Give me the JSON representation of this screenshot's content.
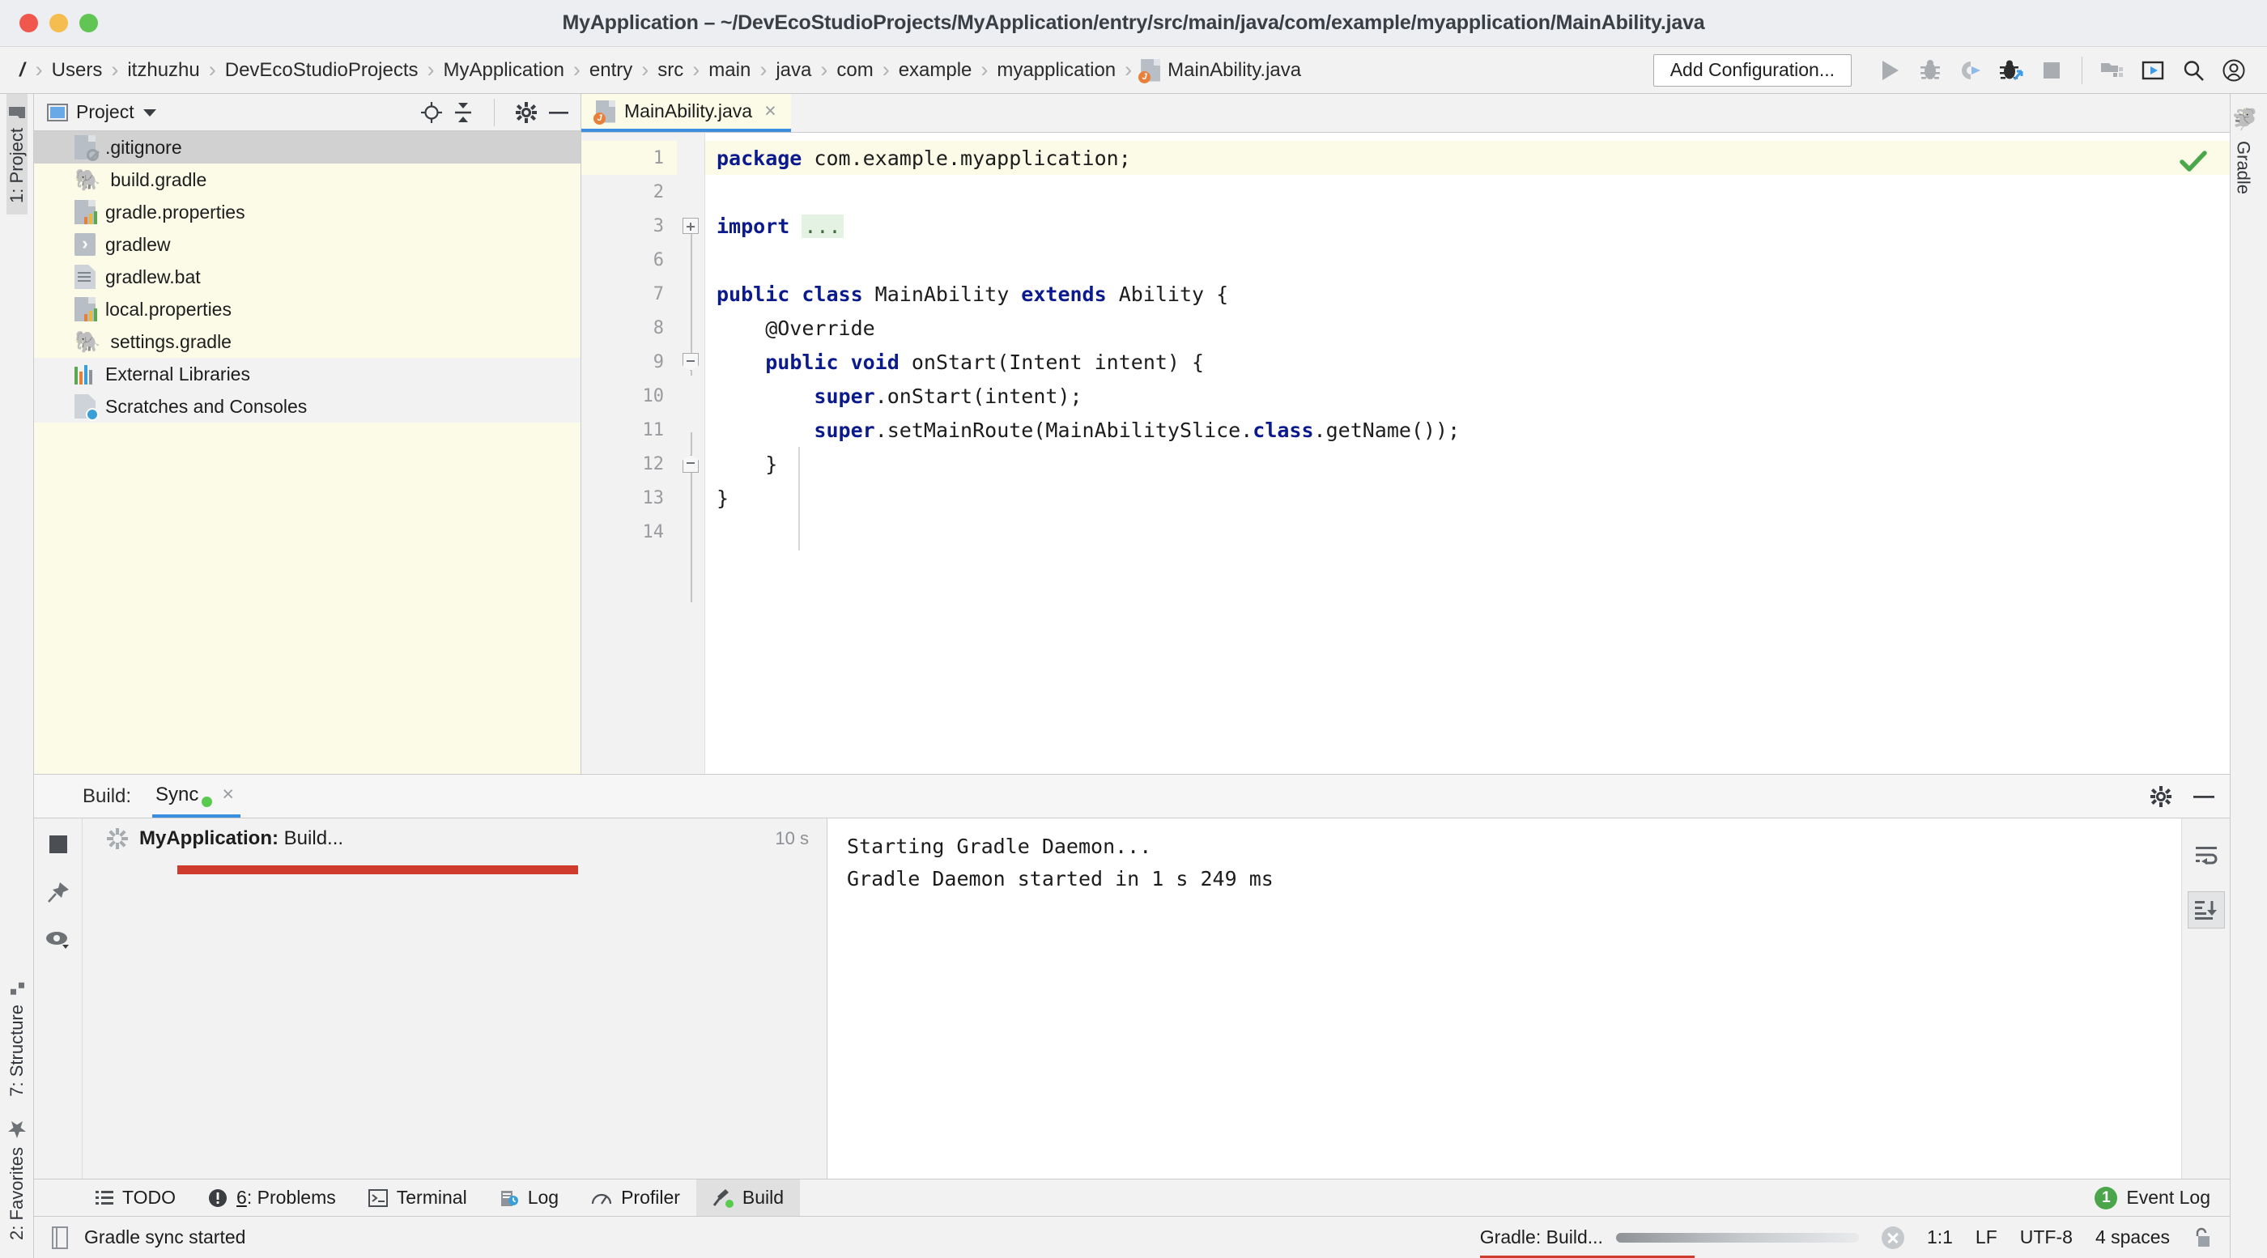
{
  "window": {
    "title": "MyApplication – ~/DevEcoStudioProjects/MyApplication/entry/src/main/java/com/example/myapplication/MainAbility.java",
    "traffic": {
      "close": "close-button",
      "minimize": "minimize-button",
      "zoom": "zoom-button"
    }
  },
  "breadcrumb": {
    "root": "/",
    "items": [
      "Users",
      "itzhuzhu",
      "DevEcoStudioProjects",
      "MyApplication",
      "entry",
      "src",
      "main",
      "java",
      "com",
      "example",
      "myapplication"
    ],
    "file": "MainAbility.java",
    "separator": "›"
  },
  "toolbar": {
    "add_configuration": "Add Configuration...",
    "icons": [
      "run-icon",
      "debug-icon",
      "run-coverage-icon",
      "profile-icon",
      "stop-icon",
      "device-manager-icon",
      "avd-manager-icon",
      "search-icon",
      "account-icon"
    ]
  },
  "left_stripe": {
    "top": [
      {
        "label": "1: Project",
        "icon": "folder-icon",
        "active": true
      }
    ],
    "bottom": [
      {
        "label": "7: Structure",
        "icon": "structure-icon"
      },
      {
        "label": "2: Favorites",
        "icon": "star-icon"
      }
    ]
  },
  "right_stripe": {
    "tabs": [
      {
        "label": "Gradle",
        "icon": "elephant-icon"
      }
    ]
  },
  "project_panel": {
    "title": "Project",
    "dropdown": "chevron-down-icon",
    "header_icons": [
      "locate-icon",
      "collapse-all-icon",
      "settings-gear-icon",
      "hide-icon"
    ],
    "items": [
      {
        "label": ".gitignore",
        "icon": "gitignore-file-icon",
        "selected": true,
        "bg": "selected"
      },
      {
        "label": "build.gradle",
        "icon": "gradle-elephant-icon",
        "bg": "cream"
      },
      {
        "label": "gradle.properties",
        "icon": "properties-file-icon",
        "bg": "cream"
      },
      {
        "label": "gradlew",
        "icon": "shell-script-icon",
        "bg": "cream"
      },
      {
        "label": "gradlew.bat",
        "icon": "bat-file-icon",
        "bg": "cream"
      },
      {
        "label": "local.properties",
        "icon": "properties-file-icon",
        "bg": "cream"
      },
      {
        "label": "settings.gradle",
        "icon": "gradle-elephant-icon",
        "bg": "cream"
      },
      {
        "label": "External Libraries",
        "icon": "libraries-icon",
        "bg": "plain"
      },
      {
        "label": "Scratches and Consoles",
        "icon": "scratches-icon",
        "bg": "plain"
      }
    ]
  },
  "editor": {
    "tab": {
      "label": "MainAbility.java",
      "icon": "java-file-icon",
      "close": "×"
    },
    "inspection_status": "check-icon",
    "line_numbers": [
      "1",
      "2",
      "3",
      "6",
      "7",
      "8",
      "9",
      "10",
      "11",
      "12",
      "13",
      "14"
    ],
    "lines": [
      {
        "num": "1",
        "highlight": true,
        "tokens": [
          {
            "t": "package",
            "c": "kw"
          },
          {
            "t": " com.example.myapplication;",
            "c": "pl"
          }
        ]
      },
      {
        "num": "2",
        "highlight": false,
        "tokens": []
      },
      {
        "num": "3",
        "highlight": false,
        "fold": "plus",
        "tokens": [
          {
            "t": "import",
            "c": "kw"
          },
          {
            "t": " ",
            "c": "pl"
          },
          {
            "t": "...",
            "c": "fold-ph"
          }
        ]
      },
      {
        "num": "6",
        "highlight": false,
        "tokens": []
      },
      {
        "num": "7",
        "highlight": false,
        "tokens": [
          {
            "t": "public class",
            "c": "kw"
          },
          {
            "t": " MainAbility ",
            "c": "pl"
          },
          {
            "t": "extends",
            "c": "kw"
          },
          {
            "t": " Ability {",
            "c": "pl"
          }
        ]
      },
      {
        "num": "8",
        "highlight": false,
        "tokens": [
          {
            "t": "    @Override",
            "c": "pl"
          }
        ]
      },
      {
        "num": "9",
        "highlight": false,
        "fold": "cap",
        "tokens": [
          {
            "t": "    ",
            "c": "pl"
          },
          {
            "t": "public void",
            "c": "kw"
          },
          {
            "t": " onStart(Intent intent) {",
            "c": "pl"
          }
        ]
      },
      {
        "num": "10",
        "highlight": false,
        "tokens": [
          {
            "t": "        ",
            "c": "pl"
          },
          {
            "t": "super",
            "c": "kw"
          },
          {
            "t": ".onStart(intent);",
            "c": "pl"
          }
        ]
      },
      {
        "num": "11",
        "highlight": false,
        "tokens": [
          {
            "t": "        ",
            "c": "pl"
          },
          {
            "t": "super",
            "c": "kw"
          },
          {
            "t": ".setMainRoute(MainAbilitySlice.",
            "c": "pl"
          },
          {
            "t": "class",
            "c": "kw"
          },
          {
            "t": ".getName());",
            "c": "pl"
          }
        ]
      },
      {
        "num": "12",
        "highlight": false,
        "fold": "capbot",
        "tokens": [
          {
            "t": "    }",
            "c": "pl"
          }
        ]
      },
      {
        "num": "13",
        "highlight": false,
        "tokens": [
          {
            "t": "}",
            "c": "pl"
          }
        ]
      },
      {
        "num": "14",
        "highlight": false,
        "tokens": []
      }
    ]
  },
  "build_panel": {
    "label": "Build:",
    "tab": "Sync",
    "tab_status": "green-dot",
    "tab_close": "×",
    "header_icons": [
      "settings-gear-icon",
      "hide-icon"
    ],
    "tool_icons": [
      "stop-icon",
      "pin-icon",
      "eye-icon"
    ],
    "tree": [
      {
        "name": "MyApplication:",
        "sub": " Build...",
        "time": "10 s",
        "spinner": "loading-spinner-icon",
        "error_bar": true
      }
    ],
    "console": [
      "Starting Gradle Daemon...",
      "Gradle Daemon started in 1 s 249 ms"
    ],
    "rail_icons": [
      "soft-wrap-icon",
      "scroll-to-end-icon"
    ]
  },
  "bottom_tabs": {
    "tabs": [
      {
        "label": "TODO",
        "icon": "todo-icon",
        "active": false
      },
      {
        "label": "6: Problems",
        "icon": "problems-icon",
        "active": false,
        "mnemonic": "6"
      },
      {
        "label": "Terminal",
        "icon": "terminal-icon",
        "active": false
      },
      {
        "label": "Log",
        "icon": "log-icon",
        "active": false
      },
      {
        "label": "Profiler",
        "icon": "profiler-icon",
        "active": false
      },
      {
        "label": "Build",
        "icon": "build-hammer-icon",
        "active": true
      }
    ],
    "event_log": {
      "label": "Event Log",
      "count": "1"
    }
  },
  "status_bar": {
    "message": "Gradle sync started",
    "message_icon": "document-icon",
    "progress_label": "Gradle: Build...",
    "cancel_icon": "cancel-icon",
    "caret": "1:1",
    "line_separator": "LF",
    "encoding": "UTF-8",
    "indent": "4 spaces",
    "lock_icon": "unlocked-icon"
  }
}
